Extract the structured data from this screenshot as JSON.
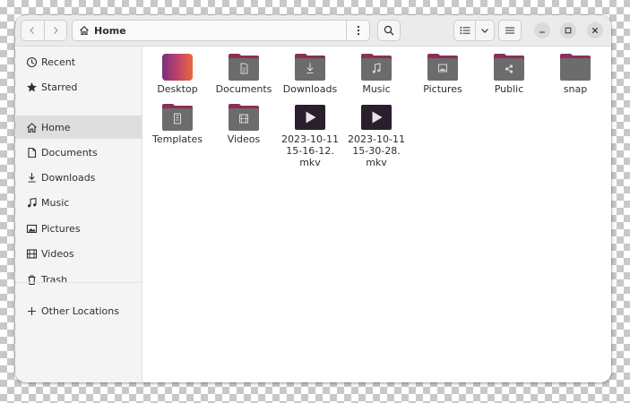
{
  "header": {
    "path_label": "Home"
  },
  "colors": {
    "accent": "#e95420",
    "folder_tab": "#8c2e57",
    "folder_body": "#6c6c6c",
    "video_thumb": "#2b1e2e"
  },
  "sidebar": {
    "items": [
      {
        "label": "Recent",
        "icon": "clock-icon"
      },
      {
        "label": "Starred",
        "icon": "star-icon"
      },
      {
        "label": "Home",
        "icon": "home-icon",
        "active": true
      },
      {
        "label": "Documents",
        "icon": "document-icon"
      },
      {
        "label": "Downloads",
        "icon": "download-icon"
      },
      {
        "label": "Music",
        "icon": "music-note-icon"
      },
      {
        "label": "Pictures",
        "icon": "picture-icon"
      },
      {
        "label": "Videos",
        "icon": "film-icon"
      },
      {
        "label": "Trash",
        "icon": "trash-icon"
      },
      {
        "label": "Other Locations",
        "icon": "plus-icon"
      }
    ]
  },
  "files": [
    {
      "name": "Desktop",
      "type": "desktop-folder"
    },
    {
      "name": "Documents",
      "type": "folder",
      "emblem": "document-icon"
    },
    {
      "name": "Downloads",
      "type": "folder",
      "emblem": "download-icon"
    },
    {
      "name": "Music",
      "type": "folder",
      "emblem": "music-note-icon"
    },
    {
      "name": "Pictures",
      "type": "folder",
      "emblem": "picture-icon"
    },
    {
      "name": "Public",
      "type": "folder",
      "emblem": "share-icon"
    },
    {
      "name": "snap",
      "type": "folder",
      "emblem": ""
    },
    {
      "name": "Templates",
      "type": "folder",
      "emblem": "template-icon"
    },
    {
      "name": "Videos",
      "type": "folder",
      "emblem": "film-icon"
    },
    {
      "name": "2023-10-11 15-16-12. mkv",
      "name_lines": [
        "2023-10-11",
        "15-16-12.",
        "mkv"
      ],
      "type": "video"
    },
    {
      "name": "2023-10-11 15-30-28. mkv",
      "name_lines": [
        "2023-10-11",
        "15-30-28.",
        "mkv"
      ],
      "type": "video"
    }
  ]
}
